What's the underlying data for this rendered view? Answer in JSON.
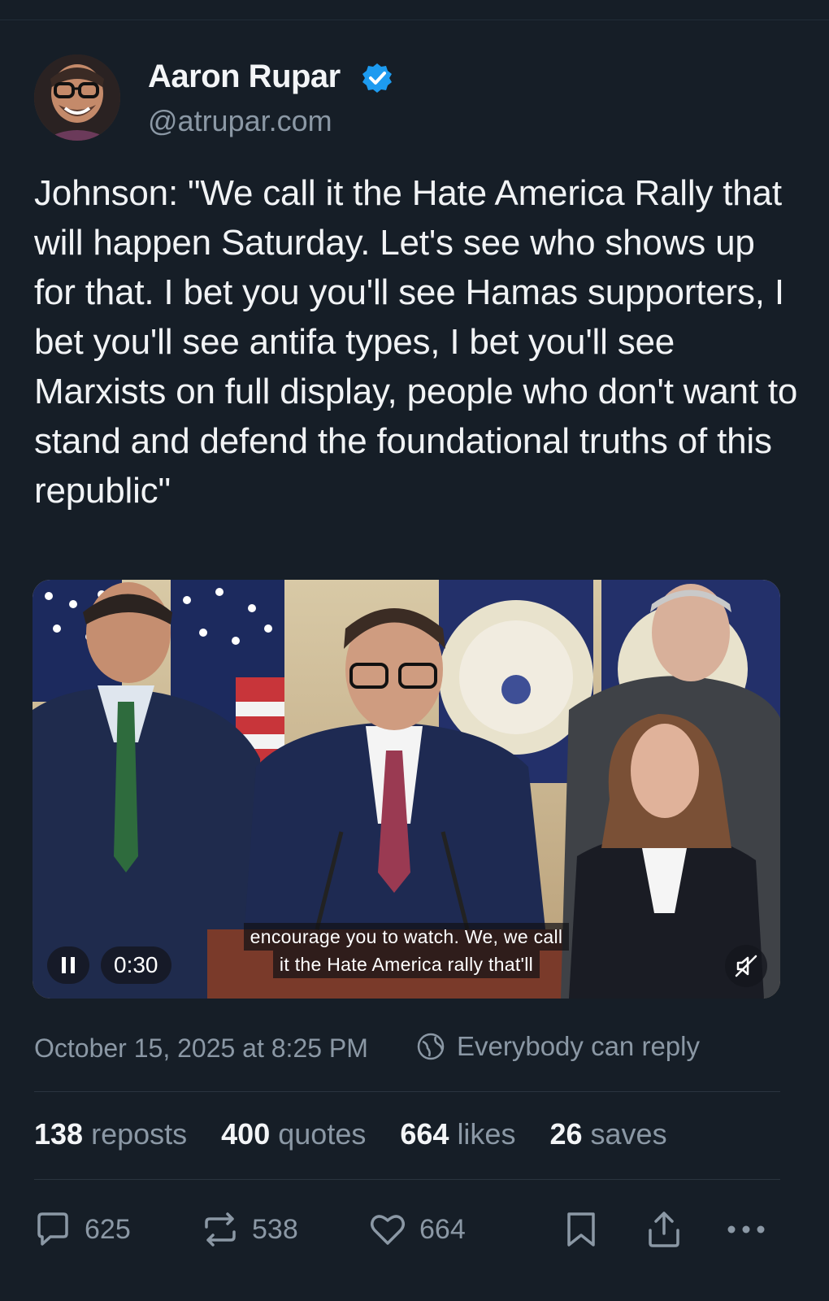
{
  "author": {
    "name": "Aaron Rupar",
    "handle": "@atrupar.com",
    "verified": true,
    "verified_color": "#1d9bf0"
  },
  "post": {
    "text": "Johnson: \"We call it the Hate America Rally that will happen Saturday. Let's see who shows up for that. I bet you you'll see Hamas supporters, I bet you'll see antifa types, I bet you'll see Marxists on full display, people who don't want to stand and defend the foundational truths of this republic\""
  },
  "video": {
    "elapsed": "0:30",
    "state": "playing",
    "captions": [
      "encourage you to watch. We, we call",
      "it the Hate America rally that'll"
    ],
    "muted": true
  },
  "meta": {
    "timestamp": "October 15, 2025 at 8:25 PM",
    "reply_scope": "Everybody can reply"
  },
  "stats": [
    {
      "count": "138",
      "label": "reposts"
    },
    {
      "count": "400",
      "label": "quotes"
    },
    {
      "count": "664",
      "label": "likes"
    },
    {
      "count": "26",
      "label": "saves"
    }
  ],
  "actions": {
    "reply_count": "625",
    "repost_count": "538",
    "like_count": "664"
  },
  "colors": {
    "background": "#161e27",
    "text_primary": "#f1f3f5",
    "text_secondary": "#8b98a5"
  }
}
